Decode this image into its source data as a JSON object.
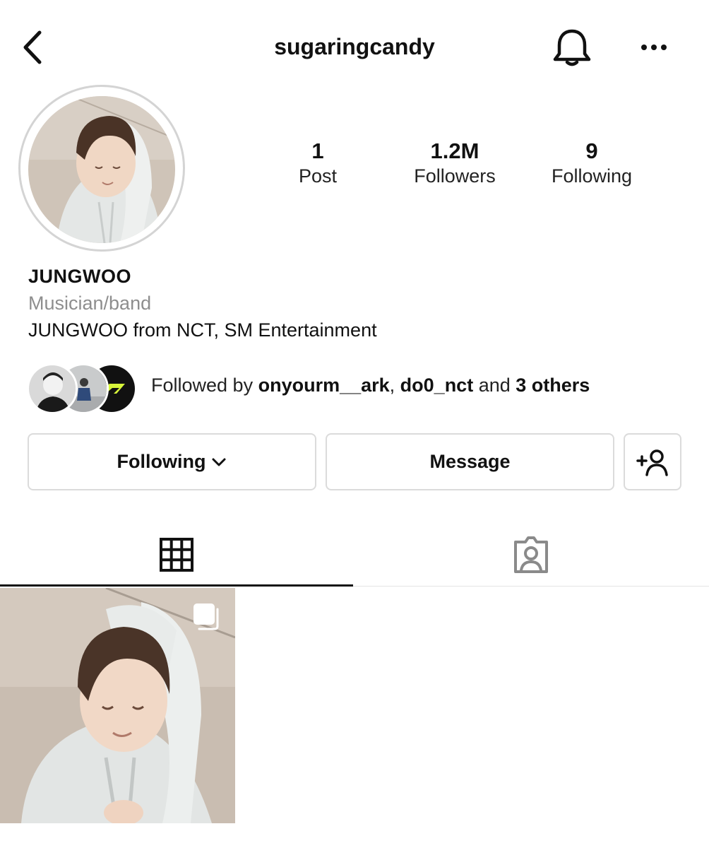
{
  "header": {
    "username": "sugaringcandy",
    "icons": {
      "back": "back-chevron-icon",
      "notifications": "bell-icon",
      "more": "more-options-icon"
    }
  },
  "profile": {
    "avatar_icon": "profile-photo",
    "stats": {
      "posts": {
        "value": "1",
        "label": "Post"
      },
      "followers": {
        "value": "1.2M",
        "label": "Followers"
      },
      "following": {
        "value": "9",
        "label": "Following"
      }
    },
    "name": "JUNGWOO",
    "category": "Musician/band",
    "bio": "JUNGWOO from NCT, SM Entertainment"
  },
  "followed_by": {
    "prefix": "Followed by ",
    "user1": "onyourm__ark",
    "sep": ", ",
    "user2": "do0_nct",
    "mid": " and ",
    "others": "3 others"
  },
  "actions": {
    "following_label": "Following",
    "message_label": "Message",
    "icons": {
      "following_dropdown": "chevron-down-icon",
      "add_user": "add-user-icon"
    }
  },
  "tabs": {
    "grid_icon": "grid-icon",
    "tagged_icon": "tagged-person-icon",
    "active": "grid"
  },
  "posts": {
    "count_shown": 1,
    "multi_photo_icon": "multiple-photos-icon"
  },
  "colors": {
    "text": "#111111",
    "secondary_text": "#8e8e8e",
    "border": "#dbdbdb",
    "avatar_ring": "#d4d4d4",
    "tab_active": "#111111"
  }
}
